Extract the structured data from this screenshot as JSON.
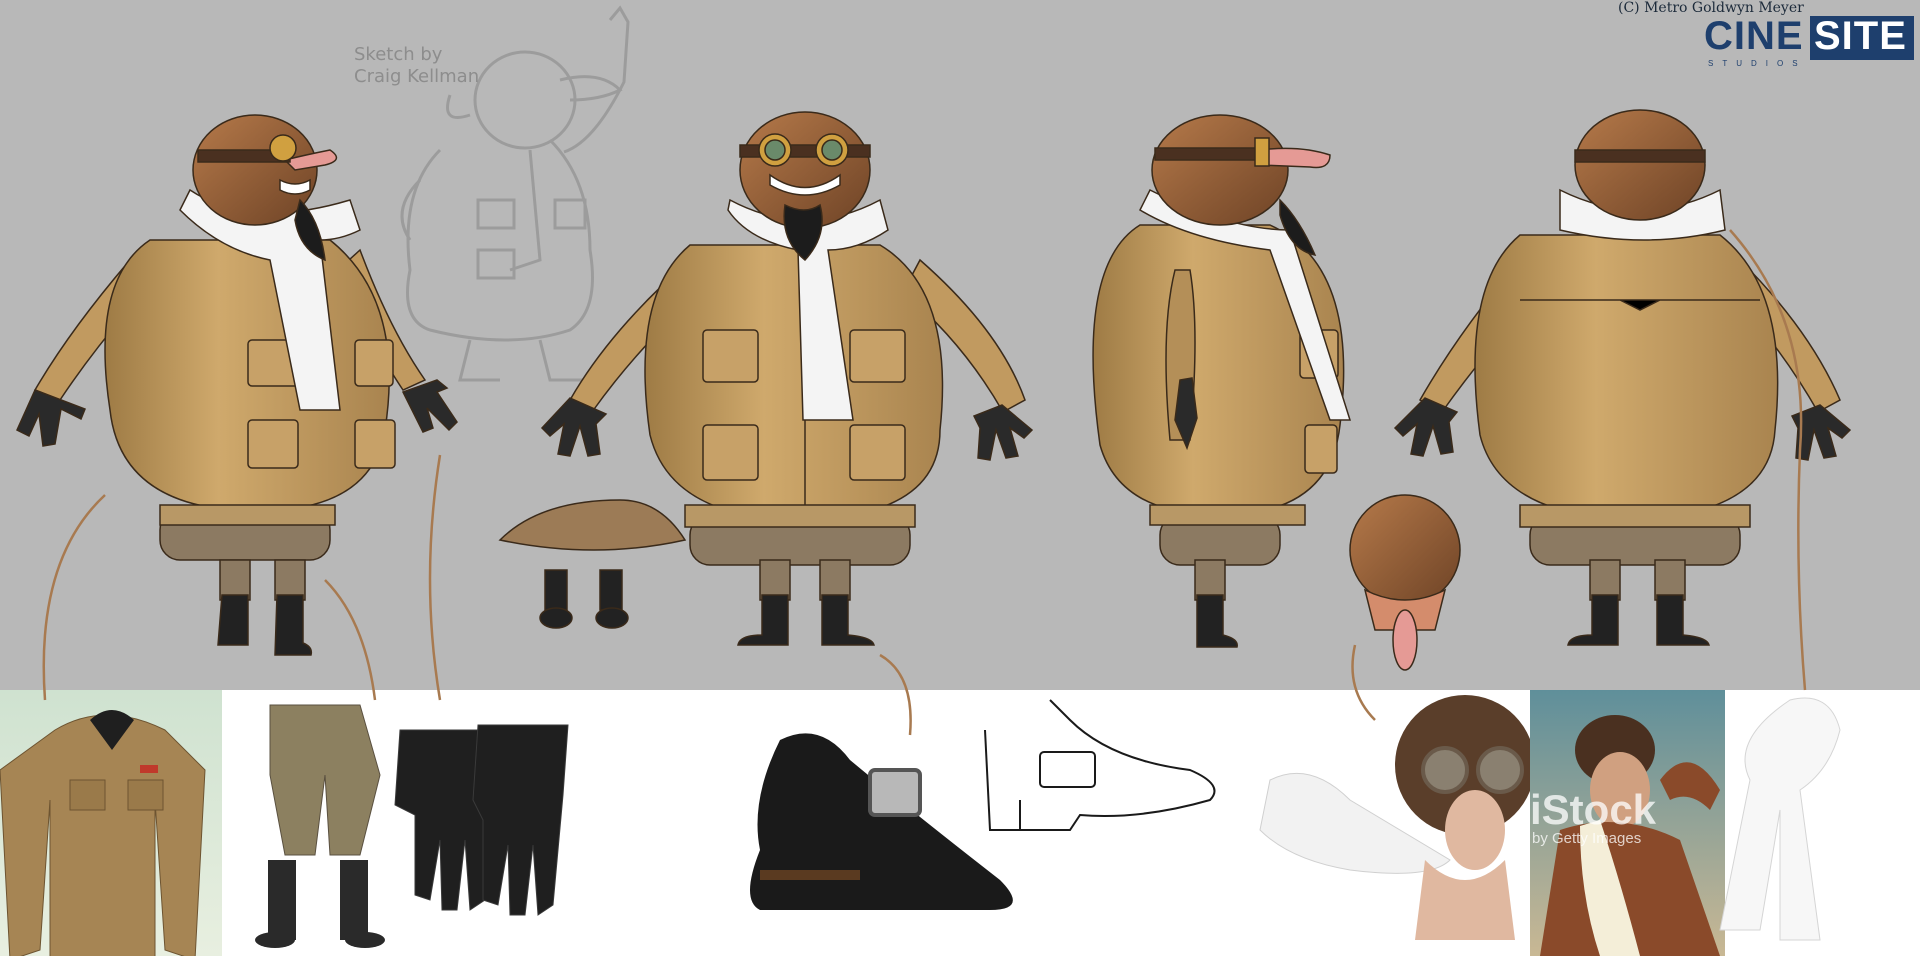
{
  "sketch_credit": {
    "line1": "Sketch by",
    "line2": "Craig Kellman"
  },
  "copyright": "(C) Metro Goldwyn Meyer",
  "logo": {
    "cine": "CINE",
    "site": "SITE",
    "studios": "STUDIOS"
  },
  "stock_watermark": {
    "brand": "iStock",
    "byline": "by Getty Images"
  },
  "colors": {
    "backdrop_gray": "#b8b8b8",
    "jacket_tan": "#c9a46a",
    "leather_brown": "#8a5a3a",
    "trousers_brown": "#8c7a62",
    "scarf_white": "#f4f4f4",
    "arrow_brown": "#a87a50",
    "logo_navy": "#1e3f6d"
  },
  "views": [
    "front-three-quarter",
    "front",
    "side",
    "back"
  ],
  "reference_photos": [
    "jacket",
    "trousers-boots",
    "gloves",
    "buckle-shoe",
    "shoe-sketch",
    "aviator-helmet-goggles",
    "pilot-photo",
    "white-scarf"
  ]
}
